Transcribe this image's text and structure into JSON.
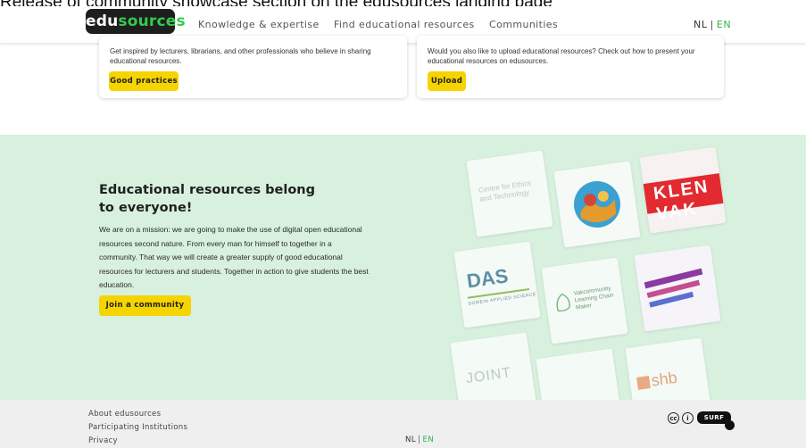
{
  "caption": "Release of community showcase section on the edusources landing page",
  "header": {
    "logo_part1": "edu",
    "logo_part2": "sources",
    "nav": [
      {
        "label": "Knowledge & expertise"
      },
      {
        "label": "Find educational resources"
      },
      {
        "label": "Communities"
      }
    ],
    "lang": {
      "nl": "NL",
      "sep": "|",
      "en": "EN"
    }
  },
  "cards": {
    "left": {
      "text": "Get inspired by lecturers, librarians, and other professionals who believe in sharing educational resources.",
      "button": "Good practices"
    },
    "right": {
      "text": "Would you also like to upload educational resources? Check out how to present your educational resources on edusources.",
      "button": "Upload"
    }
  },
  "mission": {
    "title": "Educational resources belong to everyone!",
    "body": "We are on a mission: we are going to make the use of digital open educational resources second nature. From every man for himself to together in a community. That way we will create a greater supply of good educational resources for lecturers and students. Together in action to give students the best education.",
    "button": "Join a community"
  },
  "showcase": {
    "tiles": [
      {
        "name": "centre-ethics",
        "text": "Centre for Ethics and Technology"
      },
      {
        "name": "circle-logo",
        "text": ""
      },
      {
        "name": "klenvak",
        "text": "KLEN VAK"
      },
      {
        "name": "das",
        "text": "DAS"
      },
      {
        "name": "das-sub",
        "text": "DOMEIN APPLIED SCIENCE"
      },
      {
        "name": "vakcommunity",
        "text": "Vakcommunity Learning Chain Maker"
      },
      {
        "name": "joint",
        "text": "JOINT"
      },
      {
        "name": "shb",
        "text": "shb"
      }
    ]
  },
  "footer": {
    "links": [
      {
        "label": "About edusources"
      },
      {
        "label": "Participating Institutions"
      },
      {
        "label": "Privacy"
      }
    ],
    "lang": {
      "nl": "NL",
      "sep": "|",
      "en": "EN"
    },
    "badges": {
      "cc": "cc",
      "by": "i",
      "surf": "SURF"
    }
  },
  "colors": {
    "brand_green": "#36c94f",
    "button_yellow": "#f6d400",
    "section_green": "#d8f0de",
    "footer_gray": "#efefef"
  }
}
